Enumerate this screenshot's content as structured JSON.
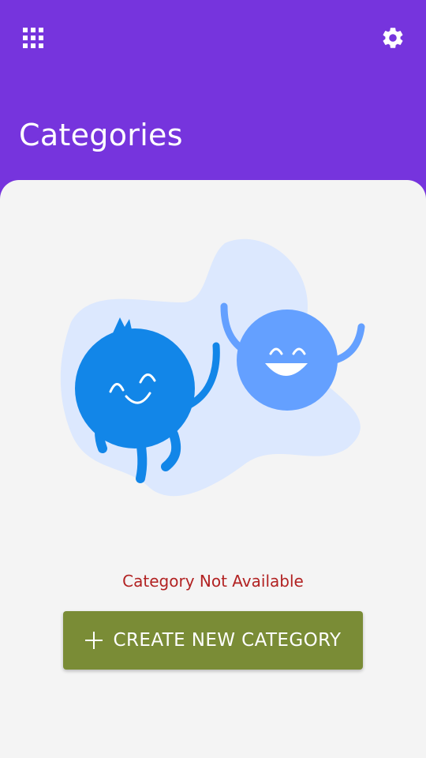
{
  "header": {
    "title": "Categories",
    "menu_icon": "apps-grid-icon",
    "settings_icon": "gear-icon"
  },
  "empty_state": {
    "illustration": "happy-monsters-illustration",
    "message": "Category Not Available"
  },
  "actions": {
    "create_label": "CREATE NEW CATEGORY",
    "create_icon": "plus-icon"
  },
  "colors": {
    "primary": "#7634dd",
    "background": "#f4f4f4",
    "button": "#7a8c36",
    "error_text": "#b22222",
    "monster_dark": "#1286e8",
    "monster_light": "#64a0ff",
    "blob": "#dce8fe"
  }
}
